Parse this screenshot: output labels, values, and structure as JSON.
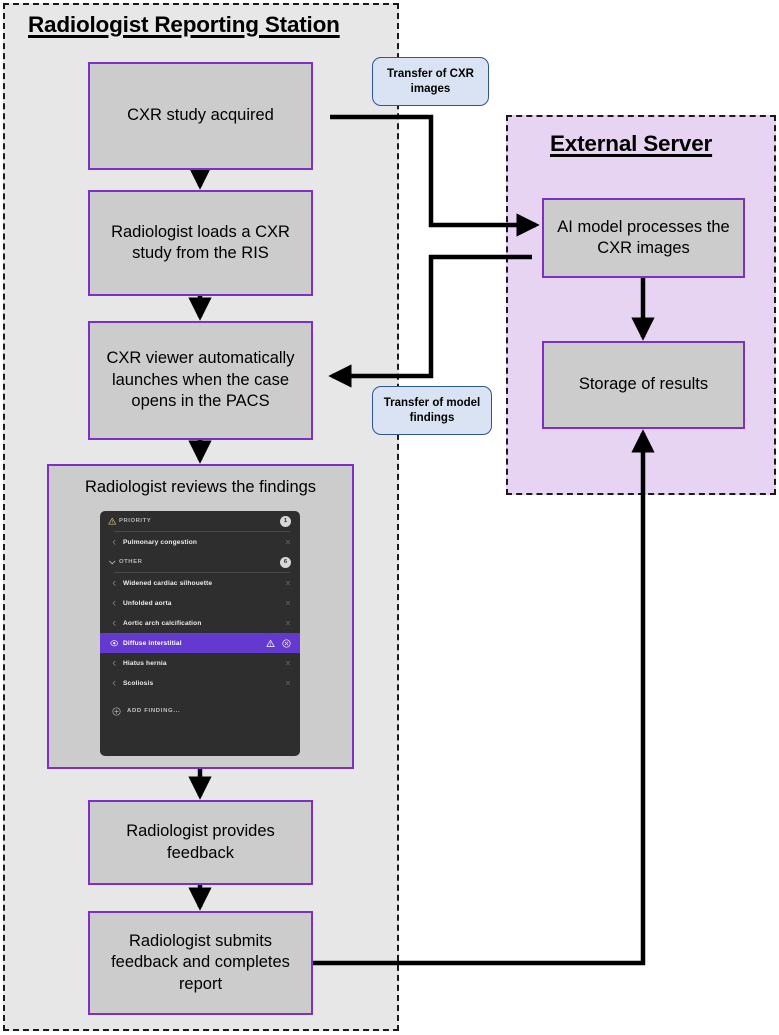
{
  "lanes": {
    "station": {
      "title": "Radiologist Reporting Station"
    },
    "server": {
      "title": "External Server"
    }
  },
  "boxes": {
    "acquired": "CXR study acquired",
    "loads": "Radiologist loads a CXR study from the RIS",
    "viewer": "CXR viewer automatically launches when the case opens in the PACS",
    "reviews": "Radiologist reviews the findings",
    "feedback": "Radiologist provides feedback",
    "submits": "Radiologist submits feedback and completes report",
    "ai_model": "AI model processes the CXR images",
    "storage": "Storage of results"
  },
  "connector_labels": {
    "transfer_images": "Transfer of CXR images",
    "transfer_findings": "Transfer of model findings"
  },
  "findings_panel": {
    "sections": [
      {
        "name": "PRIORITY",
        "icon": "warning-triangle-icon",
        "count": "1",
        "rows": [
          {
            "label": "Pulmonary congestion",
            "lead_icon": "chevron-left-icon",
            "selected": false,
            "actions": [
              "close-icon"
            ]
          }
        ]
      },
      {
        "name": "OTHER",
        "icon": "chevron-down-icon",
        "count": "6",
        "rows": [
          {
            "label": "Widened cardiac silhouette",
            "lead_icon": "chevron-left-icon",
            "selected": false,
            "actions": [
              "close-icon"
            ]
          },
          {
            "label": "Unfolded aorta",
            "lead_icon": "chevron-left-icon",
            "selected": false,
            "actions": [
              "close-icon"
            ]
          },
          {
            "label": "Aortic arch calcification",
            "lead_icon": "chevron-left-icon",
            "selected": false,
            "actions": [
              "close-icon"
            ]
          },
          {
            "label": "Diffuse interstitial",
            "lead_icon": "eye-icon",
            "selected": true,
            "actions": [
              "warning-triangle-icon",
              "circle-close-icon"
            ]
          },
          {
            "label": "Hiatus hernia",
            "lead_icon": "chevron-left-icon",
            "selected": false,
            "actions": [
              "close-icon"
            ]
          },
          {
            "label": "Scoliosis",
            "lead_icon": "chevron-left-icon",
            "selected": false,
            "actions": [
              "close-icon"
            ]
          }
        ]
      }
    ],
    "add_finding": {
      "label": "ADD FINDING...",
      "icon": "plus-circle-icon"
    },
    "selected_row_color": "#6339d0",
    "panel_background": "#2e2e2e"
  },
  "colors": {
    "station_lane_bg": "#e7e7e7",
    "server_lane_bg": "#e7d4f2",
    "process_box_fill": "#cccccc",
    "process_box_border": "#7d2fc7",
    "annotation_fill": "#dae3f3",
    "annotation_border": "#2e5597",
    "connector": "#000000"
  }
}
